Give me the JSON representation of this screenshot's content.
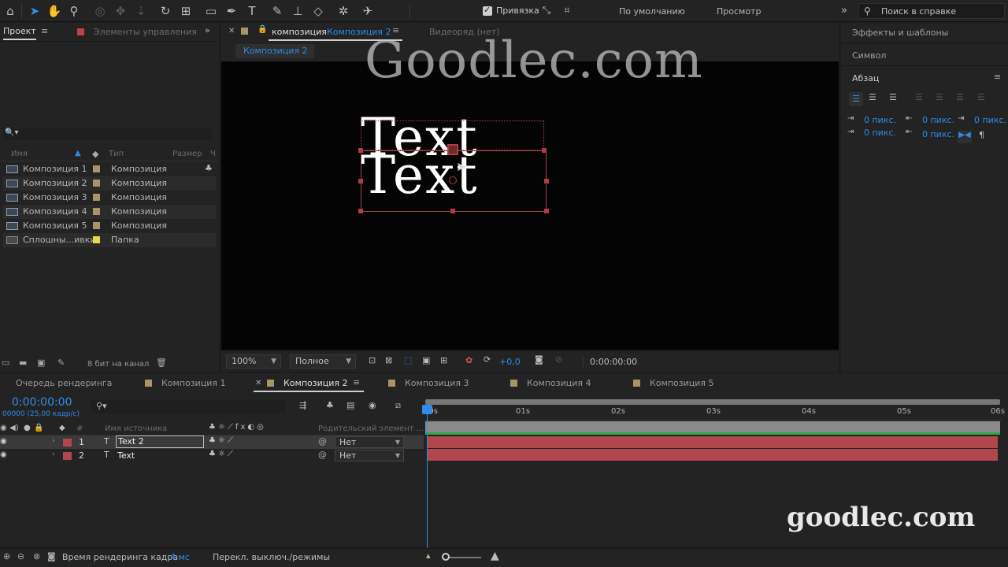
{
  "toolbar": {
    "snap_label": "Привязка",
    "workspace_default": "По умолчанию",
    "workspace_review": "Просмотр",
    "help_search_placeholder": "Поиск в справке"
  },
  "project_panel": {
    "tab_project": "Проект",
    "tab_effect_controls": "Элементы управления",
    "search_icon": "🔍▾",
    "columns": {
      "name": "Имя",
      "type": "Тип",
      "size": "Размер",
      "extra": "Ч"
    },
    "items": [
      {
        "name": "Композиция 1",
        "type": "Композиция"
      },
      {
        "name": "Композиция 2",
        "type": "Композиция"
      },
      {
        "name": "Композиция 3",
        "type": "Композиция"
      },
      {
        "name": "Композиция 4",
        "type": "Композиция"
      },
      {
        "name": "Композиция 5",
        "type": "Композиция"
      },
      {
        "name": "Сплошны...ивки",
        "type": "Папка"
      }
    ],
    "bit_depth": "8 бит на канал"
  },
  "composition_panel": {
    "tab_prefix": "композиция",
    "tab_name": "Композиция 2",
    "footage_tab": "Видеоряд (нет)",
    "breadcrumb": "Композиция 2",
    "canvas_text_1": "Text",
    "canvas_text_2": "Text",
    "zoom": "100%",
    "resolution": "Полное",
    "exposure": "+0,0",
    "timecode": "0:00:00:00"
  },
  "right_panel": {
    "effects_presets": "Эффекты и шаблоны",
    "character": "Символ",
    "paragraph": "Абзац",
    "indent_values": [
      "0 пикс.",
      "0 пикс.",
      "0 пикс.",
      "0 пикс.",
      "0 пикс."
    ]
  },
  "timeline": {
    "tabs": [
      "Очередь рендеринга",
      "Композиция 1",
      "Композиция 2",
      "Композиция 3",
      "Композиция 4",
      "Композиция 5"
    ],
    "current_time": "0:00:00:00",
    "fps_info": "00000 (25,00 кадр/с)",
    "col_number": "#",
    "col_source_name": "Имя источника",
    "col_parent": "Родительский элемент ...",
    "ruler": [
      "00s",
      "01s",
      "02s",
      "03s",
      "04s",
      "05s",
      "06s"
    ],
    "layers": [
      {
        "number": "1",
        "name": "Text 2",
        "parent": "Нет"
      },
      {
        "number": "2",
        "name": "Text",
        "parent": "Нет"
      }
    ],
    "render_time_label": "Время рендеринга кадра:",
    "render_time_value": "4 мс",
    "toggle_modes": "Перекл. выключ./режимы"
  },
  "watermarks": {
    "top": "Goodlec.com",
    "bottom": "goodlec.com"
  },
  "colors": {
    "accent": "#2d8ceb",
    "label_red": "#b0474e",
    "label_tan": "#a89468",
    "label_yellow": "#e8d84a"
  }
}
